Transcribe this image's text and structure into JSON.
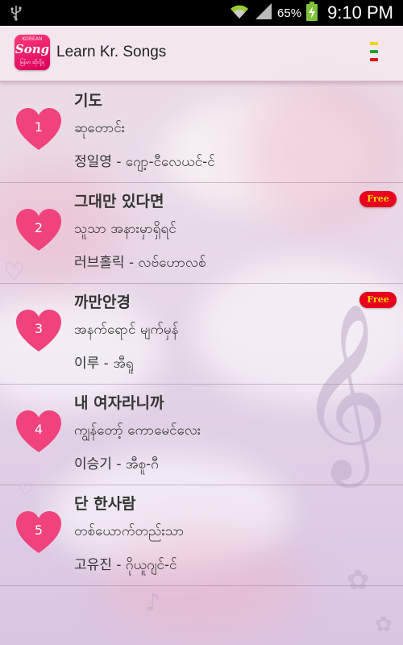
{
  "status_bar": {
    "battery_percent": "65%",
    "time": "9:10 PM",
    "icons": [
      "usb-icon",
      "wifi-icon",
      "signal-icon",
      "battery-charging-icon"
    ]
  },
  "app_bar": {
    "title": "Learn Kr. Songs",
    "app_icon_text": "Song",
    "app_icon_top_text": "KOREAN",
    "app_icon_bottom_text": "မြန်မာ ဆိုလို့ရ",
    "menu_colors": [
      "#f2d600",
      "#1aa32b",
      "#e01010"
    ]
  },
  "songs": [
    {
      "number": "1",
      "title": "기도",
      "subtitle": "ဆုတောင်း",
      "meta": "정일영 - ဂျော့-ငီလေယင်-င်",
      "free": false
    },
    {
      "number": "2",
      "title": "그대만 있다면",
      "subtitle": "သူသာ အနားမှာရှိရင်",
      "meta": "러브홀릭 - လဗ်ဟောလစ်",
      "free": true
    },
    {
      "number": "3",
      "title": "까만안경",
      "subtitle": "အနက်ရောင် မျက်မှန်",
      "meta": "이루 - အီရူ",
      "free": true
    },
    {
      "number": "4",
      "title": "내 여자라니까",
      "subtitle": "ကျွန်တော့် ကောမေင်လေး",
      "meta": "이승기 - အီစူ-ဂီ",
      "free": false
    },
    {
      "number": "5",
      "title": "단 한사람",
      "subtitle": "တစ်ယောက်တည်းသာ",
      "meta": "고유진 - ဂိုယူဂျင်-င်",
      "free": false
    }
  ],
  "free_badge": "Free",
  "colors": {
    "heart": "#f0437e",
    "badge": "#e8001c"
  }
}
